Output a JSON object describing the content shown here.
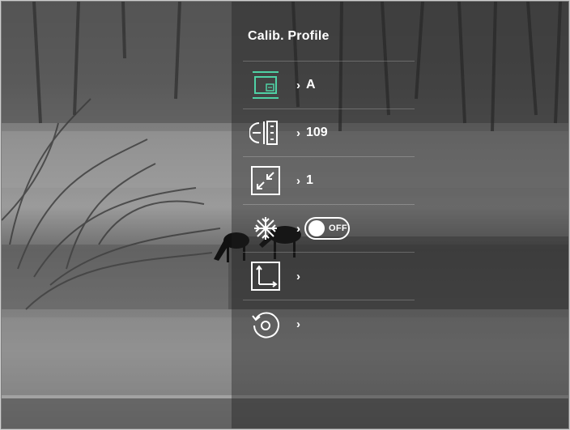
{
  "menu": {
    "title": "Calib. Profile",
    "items": [
      {
        "icon": "profile-icon",
        "value": "A"
      },
      {
        "icon": "distance-icon",
        "value": "109"
      },
      {
        "icon": "zoom-icon",
        "value": "1"
      },
      {
        "icon": "freeze-icon",
        "toggle_label": "OFF",
        "toggle_on": false
      },
      {
        "icon": "axis-icon",
        "value": ""
      },
      {
        "icon": "reset-icon",
        "value": ""
      }
    ]
  },
  "colors": {
    "accent": "#4fd1a5",
    "text": "#ffffff"
  }
}
